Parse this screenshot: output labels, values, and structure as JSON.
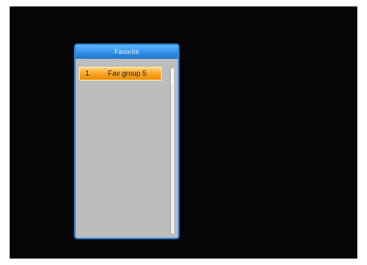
{
  "dialog": {
    "title": "Favorite"
  },
  "favorites": [
    {
      "number": "1",
      "name": "Fav group 5",
      "selected": true
    }
  ],
  "colors": {
    "background": "#050505",
    "title_bar": "#2f8fe6",
    "selection": "#f7a21f",
    "panel": "#bdbdbd"
  }
}
